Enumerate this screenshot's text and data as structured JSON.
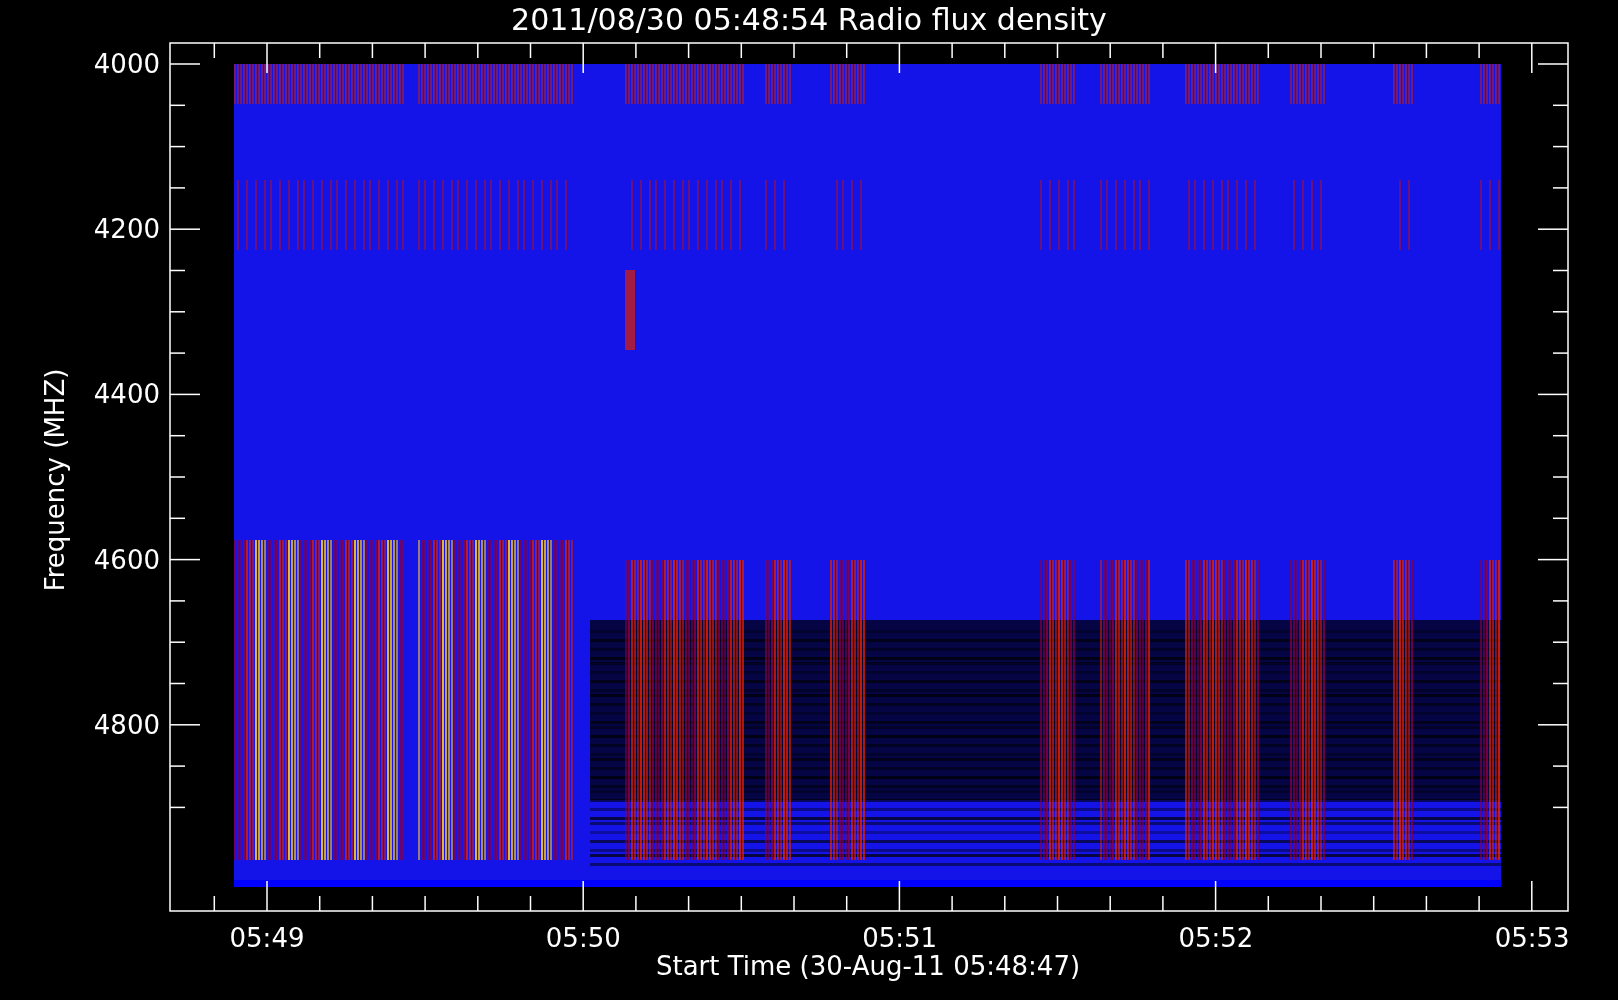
{
  "title": "2011/08/30 05:48:54 Radio flux density",
  "y_axis": {
    "label": "Frequency (MHZ)",
    "ticks": [
      "4000",
      "4200",
      "4400",
      "4600",
      "4800"
    ]
  },
  "x_axis": {
    "label": "Start Time (30-Aug-11 05:48:47)",
    "ticks": [
      "05:49",
      "05:50",
      "05:51",
      "05:52",
      "05:53"
    ]
  }
}
